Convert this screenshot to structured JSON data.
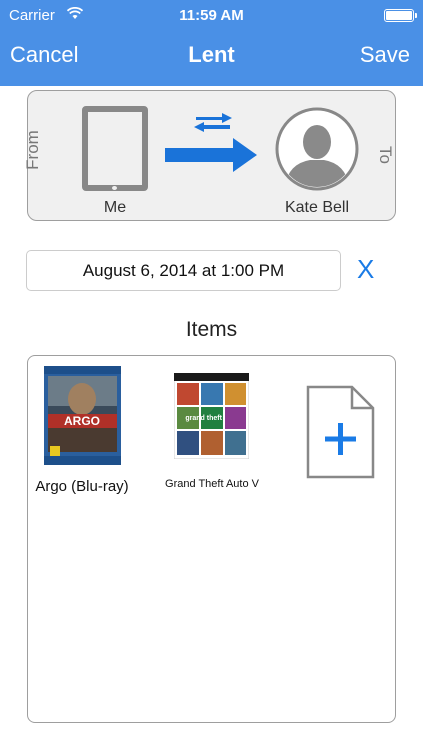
{
  "status_bar": {
    "carrier": "Carrier",
    "time": "11:59 AM"
  },
  "nav": {
    "cancel": "Cancel",
    "title": "Lent",
    "save": "Save"
  },
  "transfer": {
    "from_label": "From",
    "to_label": "To",
    "from_name": "Me",
    "to_name": "Kate Bell"
  },
  "date": {
    "value": "August 6, 2014 at 1:00 PM",
    "clear": "X"
  },
  "items": {
    "heading": "Items",
    "list": [
      {
        "label": "Argo (Blu-ray)",
        "cover_text": "ARGO"
      },
      {
        "label": "Grand Theft Auto V",
        "cover_text": "grand theft auto"
      }
    ]
  },
  "colors": {
    "header_blue": "#4a90e6",
    "accent": "#1a7be6",
    "icon_gray": "#888888"
  }
}
